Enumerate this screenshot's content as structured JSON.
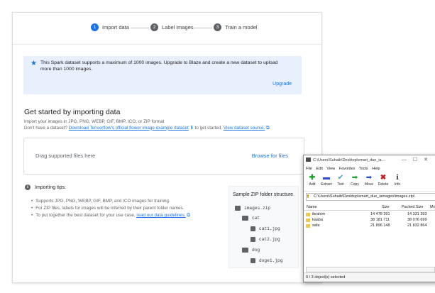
{
  "stepper": {
    "steps": [
      {
        "num": "1",
        "label": "Import data"
      },
      {
        "num": "2",
        "label": "Label images"
      },
      {
        "num": "3",
        "label": "Train a model"
      }
    ]
  },
  "banner": {
    "message": "This Spark dataset supports a maximum of 1000 images. Upgrade to Blaze and create a new dataset to upload more than 1000 images.",
    "upgrade_label": "Upgrade"
  },
  "import": {
    "heading": "Get started by importing data",
    "line1": "Import your images in JPG, PNG, WEBP, GIF, BMP, ICO, or ZIP format",
    "line2_prefix": "Don't have a dataset?",
    "line2_link": "Download Tensorflow's official flower image example dataset",
    "line2_mid": "to get started.",
    "line2_link2": "View dataset source."
  },
  "dropzone": {
    "drag_text": "Drag supported files here",
    "browse_label": "Browse for files"
  },
  "tips": {
    "heading": "Importing tips:",
    "items": [
      "Supports JPG, PNG, WEBP, GIF, BMP, and ICO images for training.",
      "For ZIP files, labels for images will be inferred by their parent folder names.",
      "To put together the best dataset for your use case,"
    ],
    "guidelines_link": "read our data guidelines."
  },
  "zip_structure": {
    "title": "Sample ZIP folder structure",
    "rows": [
      "images.zip",
      "cat",
      "cat1.jpg",
      "cat2.jpg",
      "dog",
      "doge1.jpg"
    ]
  },
  "winrar": {
    "title": "C:\\Users\\Suhaib\\Desktop\\smart_due_ia...",
    "menu": [
      "File",
      "Edit",
      "View",
      "Favorites",
      "Tools",
      "Help"
    ],
    "toolbar": [
      {
        "label": "Add",
        "icon": "plus-icon",
        "color": "#1e9e2c"
      },
      {
        "label": "Extract",
        "icon": "minus-icon",
        "color": "#2a4cc7"
      },
      {
        "label": "Test",
        "icon": "check-icon",
        "color": "#29a3c7"
      },
      {
        "label": "Copy",
        "icon": "copy-arrow-icon",
        "color": "#1e9e2c"
      },
      {
        "label": "Move",
        "icon": "move-arrow-icon",
        "color": "#2a4cc7"
      },
      {
        "label": "Delete",
        "icon": "delete-x-icon",
        "color": "#d11a1a"
      },
      {
        "label": "Info",
        "icon": "info-icon",
        "color": "#444444"
      }
    ],
    "path": "C:\\Users\\Suhaib\\Desktop\\smart_due_iamages\\images.zip\\",
    "columns": {
      "name": "Name",
      "size": "Size",
      "packed": "Packed Size",
      "mod": "Mo"
    },
    "files": [
      {
        "name": "ibrahim",
        "size": "14 478 391",
        "packed": "14 331 393"
      },
      {
        "name": "kaaba",
        "size": "38 181 711",
        "packed": "38 076 699"
      },
      {
        "name": "safa",
        "size": "21 896 148",
        "packed": "21 832 864"
      }
    ],
    "status": "0 / 3 object(s) selected"
  }
}
